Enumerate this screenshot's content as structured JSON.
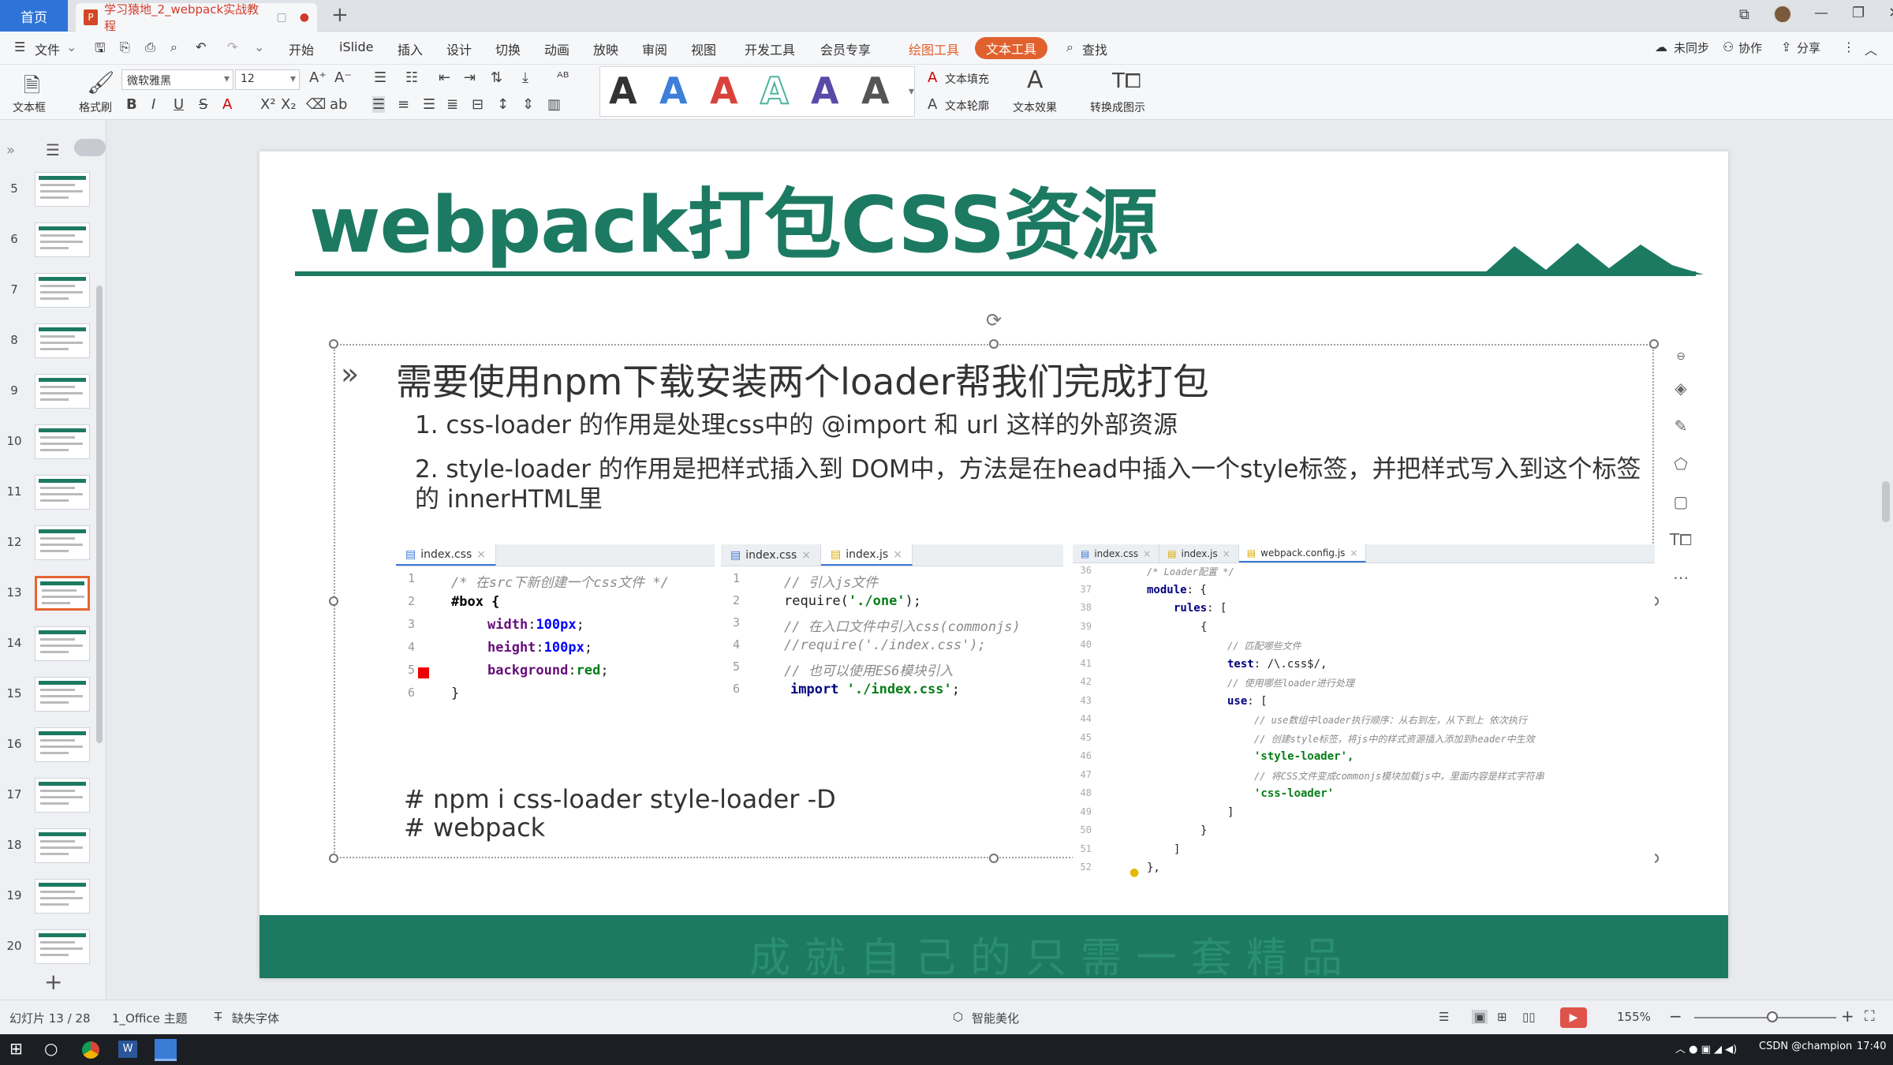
{
  "titlebar": {
    "home_tab": "首页",
    "doc_tab": "学习猿地_2_webpack实战教程",
    "doc_icon": "P",
    "new_tab": "+"
  },
  "menu": {
    "file": "文件",
    "items": [
      "开始",
      "iSlide",
      "插入",
      "设计",
      "切换",
      "动画",
      "放映",
      "审阅",
      "视图",
      "开发工具",
      "会员专享"
    ],
    "drawing_tools": "绘图工具",
    "text_tools": "文本工具",
    "search": "查找",
    "right": [
      "未同步",
      "协作",
      "分享"
    ]
  },
  "ribbon": {
    "textbox": "文本框",
    "format_painter": "格式刷",
    "font_name": "微软雅黑",
    "font_size": "12",
    "text_fill": "文本填充",
    "text_outline": "文本轮廓",
    "text_effect": "文本效果",
    "convert": "转换成图示",
    "styleA": [
      "A",
      "A",
      "A",
      "A",
      "A",
      "A"
    ],
    "styleA_colors": [
      "#000000",
      "#3d7fd9",
      "#d9423b",
      "#4fb59e",
      "#5a4aa8",
      "#555555"
    ]
  },
  "thumbnails": {
    "numbers": [
      "5",
      "6",
      "7",
      "8",
      "9",
      "10",
      "11",
      "12",
      "13",
      "14",
      "15",
      "16",
      "17",
      "18",
      "19",
      "20"
    ],
    "selected": "13",
    "add": "+"
  },
  "slide": {
    "title": "webpack打包CSS资源",
    "bullet_mark": "»",
    "bullet": "需要使用npm下载安装两个loader帮我们完成打包",
    "sub1": "1. css-loader 的作用是处理css中的 @import 和 url 这样的外部资源",
    "sub2a": "2. style-loader 的作用是把样式插入到 DOM中，方法是在head中插入一个style标签，并把样式写入到这个标签",
    "sub2b": "的 innerHTML里",
    "cmd1": "# npm i css-loader style-loader -D",
    "cmd2": "# webpack",
    "footer": "成就自己的只需一套精品"
  },
  "pane1": {
    "tabs": [
      "index.css"
    ],
    "lines": [
      "1",
      "2",
      "3",
      "4",
      "5",
      "6"
    ],
    "code": {
      "c1": "/* 在src下新创建一个css文件 */",
      "c2": "#box {",
      "c3a": "width",
      "c3b": "100px",
      "c3c": ";",
      "c4a": "height",
      "c4b": "100px",
      "c4c": ";",
      "c5a": "background",
      "c5b": "red",
      "c5c": ";",
      "c6": "}"
    }
  },
  "pane2": {
    "tabs": [
      "index.css",
      "index.js"
    ],
    "lines": [
      "1",
      "2",
      "3",
      "4",
      "5",
      "6"
    ],
    "code": {
      "c1": "// 引入js文件",
      "c2a": "require(",
      "c2b": "'./one'",
      "c2c": ");",
      "c3": "// 在入口文件中引入css(commonjs)",
      "c4": "//require('./index.css');",
      "c5": "// 也可以使用ES6模块引入",
      "c6a": "import ",
      "c6b": "'./index.css'",
      "c6c": ";"
    }
  },
  "pane3": {
    "tabs": [
      "index.css",
      "index.js",
      "webpack.config.js"
    ],
    "lines": [
      "36",
      "37",
      "38",
      "39",
      "40",
      "41",
      "42",
      "43",
      "44",
      "45",
      "46",
      "47",
      "48",
      "49",
      "50",
      "51",
      "52"
    ],
    "code": {
      "l36": "/* Loader配置 */",
      "l37a": "module",
      "l37b": ": {",
      "l38a": "rules",
      "l38b": ": [",
      "l39": "{",
      "l40": "// 匹配哪些文件",
      "l41a": "test",
      "l41b": ": /\\.css$/,",
      "l42": "// 使用哪些loader进行处理",
      "l43a": "use",
      "l43b": ": [",
      "l44": "// use数组中loader执行顺序：从右到左，从下到上 依次执行",
      "l45": "// 创建style标签，将js中的样式资源插入添加到header中生效",
      "l46": "'style-loader',",
      "l47": "// 将CSS文件变成commonjs模块加载js中，里面内容是样式字符串",
      "l48": "'css-loader'",
      "l49": "]",
      "l50": "}",
      "l51": "]",
      "l52": "},"
    }
  },
  "status": {
    "slide_count": "幻灯片 13 / 28",
    "theme": "1_Office 主题",
    "missing_font": "缺失字体",
    "beautify": "智能美化",
    "zoom": "155%",
    "minus": "−",
    "plus": "+"
  },
  "taskbar": {
    "clock": "17:40",
    "tray_text": "CSDN @champion"
  }
}
